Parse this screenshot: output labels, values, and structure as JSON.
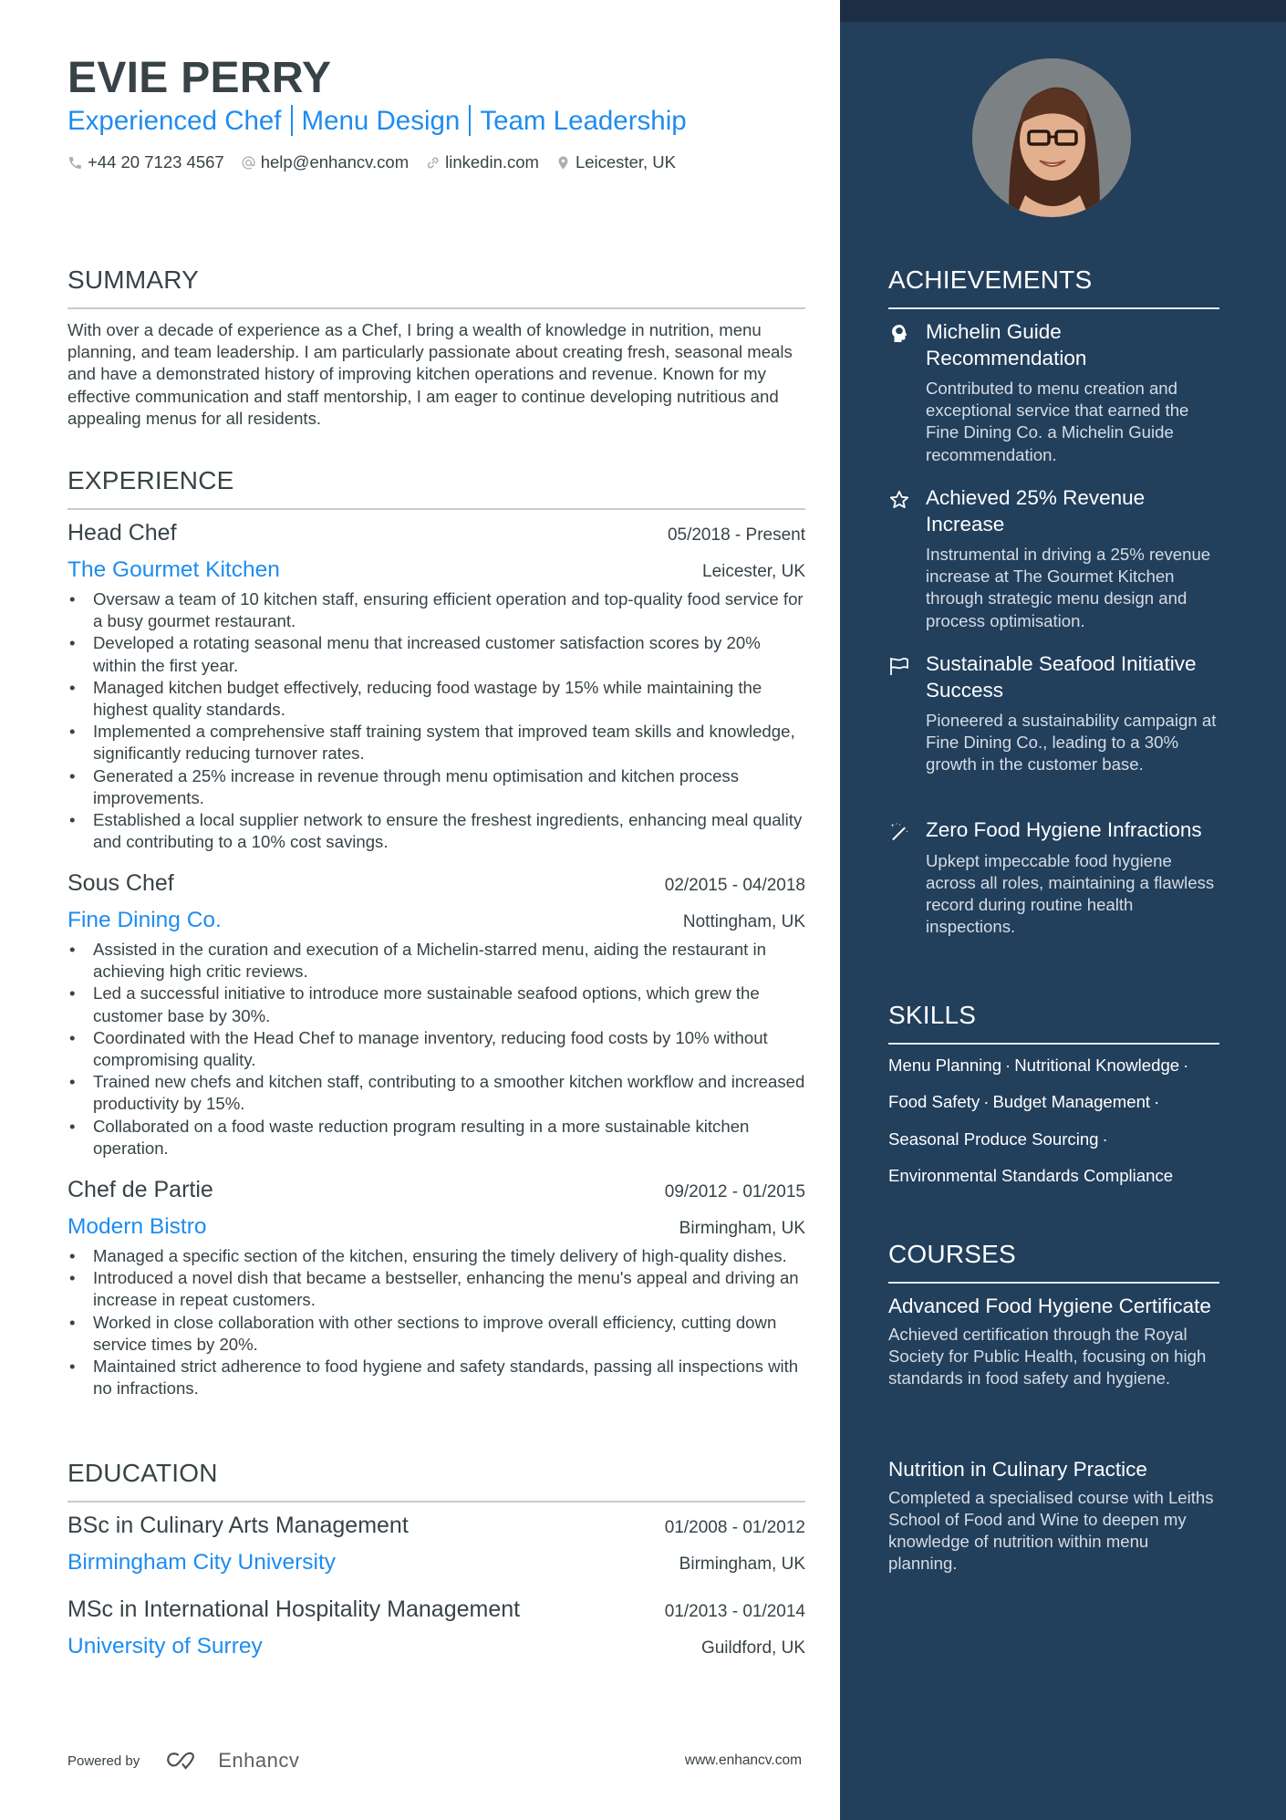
{
  "header": {
    "name": "EVIE PERRY",
    "subtitle_parts": [
      "Experienced Chef",
      "Menu Design",
      "Team Leadership"
    ],
    "contacts": {
      "phone": "+44 20 7123 4567",
      "email": "help@enhancv.com",
      "link": "linkedin.com",
      "location": "Leicester, UK"
    }
  },
  "summary": {
    "title": "SUMMARY",
    "text": "With over a decade of experience as a Chef, I bring a wealth of knowledge in nutrition, menu planning, and team leadership. I am particularly passionate about creating fresh, seasonal meals and have a demonstrated history of improving kitchen operations and revenue. Known for my effective communication and staff mentorship, I am eager to continue developing nutritious and appealing menus for all residents."
  },
  "experience": {
    "title": "EXPERIENCE",
    "jobs": [
      {
        "role": "Head Chef",
        "dates": "05/2018 - Present",
        "company": "The Gourmet Kitchen",
        "location": "Leicester, UK",
        "bullets": [
          "Oversaw a team of 10 kitchen staff, ensuring efficient operation and top-quality food service for a busy gourmet restaurant.",
          "Developed a rotating seasonal menu that increased customer satisfaction scores by 20% within the first year.",
          "Managed kitchen budget effectively, reducing food wastage by 15% while maintaining the highest quality standards.",
          "Implemented a comprehensive staff training system that improved team skills and knowledge, significantly reducing turnover rates.",
          "Generated a 25% increase in revenue through menu optimisation and kitchen process improvements.",
          "Established a local supplier network to ensure the freshest ingredients, enhancing meal quality and contributing to a 10% cost savings."
        ]
      },
      {
        "role": "Sous Chef",
        "dates": "02/2015 - 04/2018",
        "company": "Fine Dining Co.",
        "location": "Nottingham, UK",
        "bullets": [
          "Assisted in the curation and execution of a Michelin-starred menu, aiding the restaurant in achieving high critic reviews.",
          "Led a successful initiative to introduce more sustainable seafood options, which grew the customer base by 30%.",
          "Coordinated with the Head Chef to manage inventory, reducing food costs by 10% without compromising quality.",
          "Trained new chefs and kitchen staff, contributing to a smoother kitchen workflow and increased productivity by 15%.",
          "Collaborated on a food waste reduction program resulting in a more sustainable kitchen operation."
        ]
      },
      {
        "role": "Chef de Partie",
        "dates": "09/2012 - 01/2015",
        "company": "Modern Bistro",
        "location": "Birmingham, UK",
        "bullets": [
          "Managed a specific section of the kitchen, ensuring the timely delivery of high-quality dishes.",
          "Introduced a novel dish that became a bestseller, enhancing the menu's appeal and driving an increase in repeat customers.",
          "Worked in close collaboration with other sections to improve overall efficiency, cutting down service times by 20%.",
          "Maintained strict adherence to food hygiene and safety standards, passing all inspections with no infractions."
        ]
      }
    ]
  },
  "education": {
    "title": "EDUCATION",
    "items": [
      {
        "degree": "BSc in Culinary Arts Management",
        "dates": "01/2008 - 01/2012",
        "school": "Birmingham City University",
        "location": "Birmingham, UK"
      },
      {
        "degree": "MSc in International Hospitality Management",
        "dates": "01/2013 - 01/2014",
        "school": "University of Surrey",
        "location": "Guildford, UK"
      }
    ]
  },
  "footer": {
    "powered_by": "Powered by",
    "brand": "Enhancv",
    "site": "www.enhancv.com"
  },
  "achievements": {
    "title": "ACHIEVEMENTS",
    "items": [
      {
        "icon": "head-brain-icon",
        "title": "Michelin Guide Recommendation",
        "desc": "Contributed to menu creation and exceptional service that earned the Fine Dining Co. a Michelin Guide recommendation."
      },
      {
        "icon": "star-icon",
        "title": "Achieved 25% Revenue Increase",
        "desc": "Instrumental in driving a 25% revenue increase at The Gourmet Kitchen through strategic menu design and process optimisation."
      },
      {
        "icon": "flag-icon",
        "title": "Sustainable Seafood Initiative Success",
        "desc": "Pioneered a sustainability campaign at Fine Dining Co., leading to a 30% growth in the customer base."
      },
      {
        "icon": "magic-wand-icon",
        "title": "Zero Food Hygiene Infractions",
        "desc": "Upkept impeccable food hygiene across all roles, maintaining a flawless record during routine health inspections."
      }
    ]
  },
  "skills": {
    "title": "SKILLS",
    "lines": [
      [
        "Menu Planning",
        "Nutritional Knowledge"
      ],
      [
        "Food Safety",
        "Budget Management"
      ],
      [
        "Seasonal Produce Sourcing"
      ],
      [
        "Environmental Standards Compliance"
      ]
    ],
    "separator": "·"
  },
  "courses": {
    "title": "COURSES",
    "items": [
      {
        "title": "Advanced Food Hygiene Certificate",
        "desc": "Achieved certification through the Royal Society for Public Health, focusing on high standards in food safety and hygiene."
      },
      {
        "title": "Nutrition in Culinary Practice",
        "desc": "Completed a specialised course with Leiths School of Food and Wine to deepen my knowledge of nutrition within menu planning."
      }
    ]
  },
  "colors": {
    "accent": "#1E8CF0",
    "sidebar": "#223F5C",
    "sidebar_band": "#1B2E44",
    "text": "#384347"
  }
}
